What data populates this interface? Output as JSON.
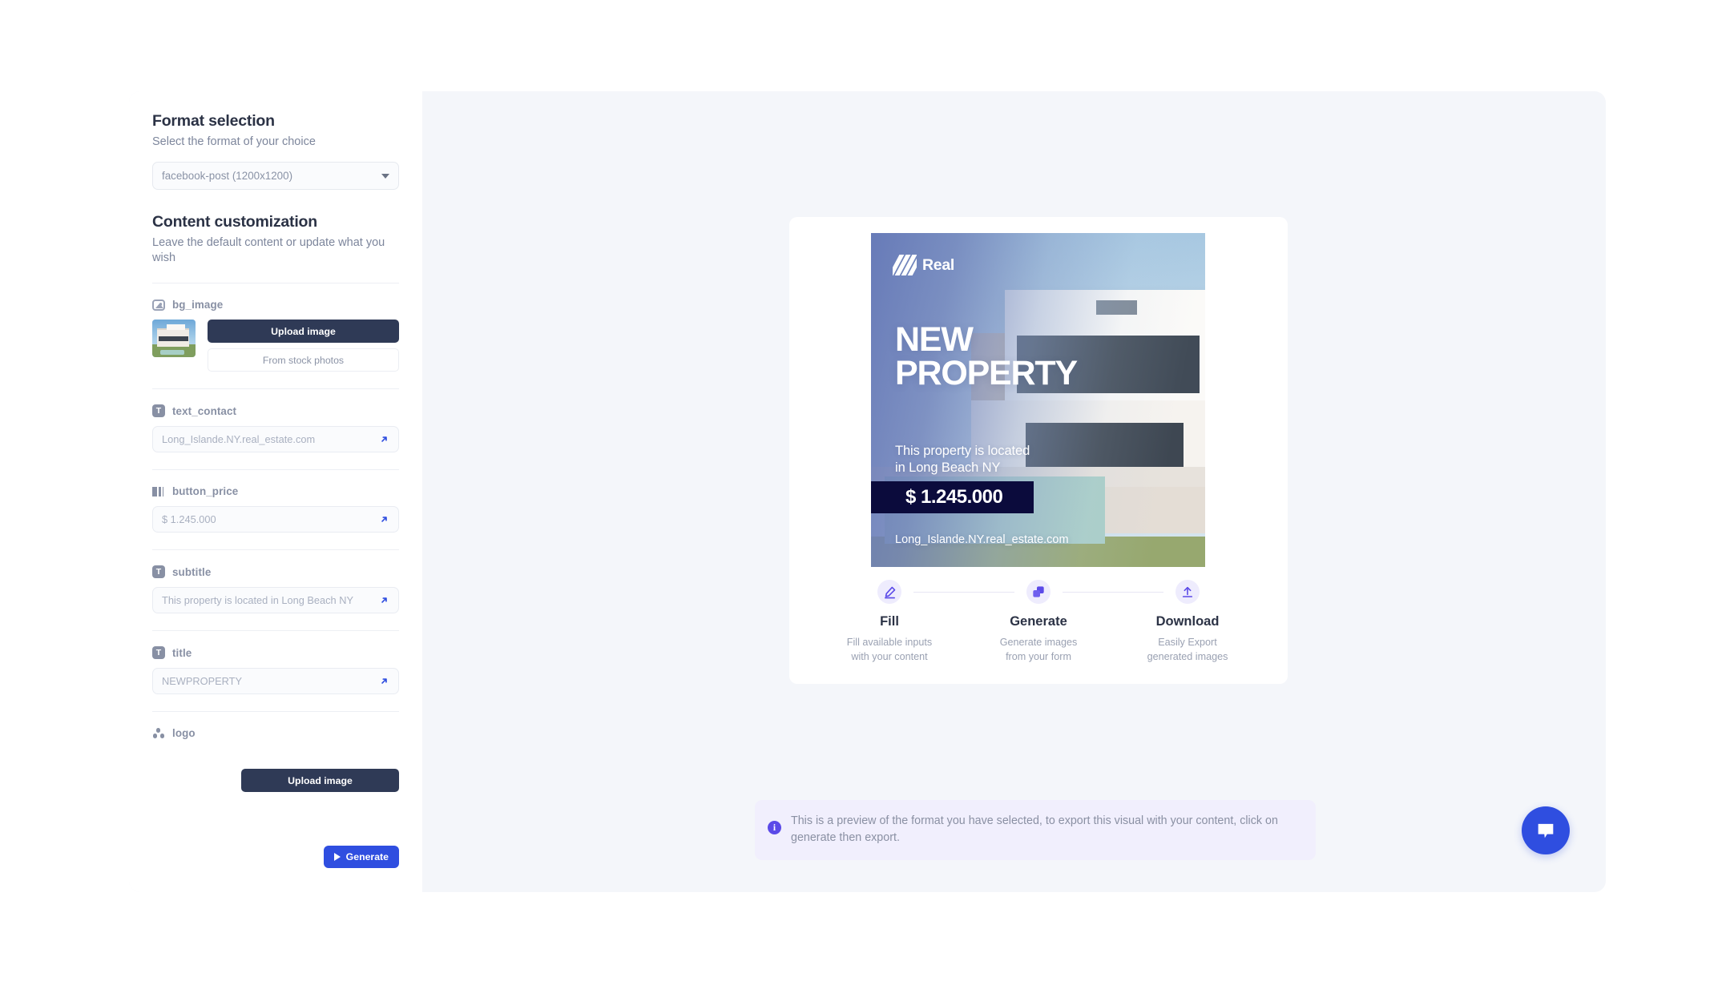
{
  "sidebar": {
    "format_section": {
      "title": "Format selection",
      "subtitle": "Select the format of your choice",
      "select_value": "facebook-post (1200x1200)"
    },
    "content_section": {
      "title": "Content customization",
      "subtitle": "Leave the default content or update what you wish"
    },
    "fields": [
      {
        "label": "bg_image",
        "icon": "picture-icon"
      },
      {
        "label": "text_contact",
        "icon": "text-icon",
        "value": "Long_Islande.NY.real_estate.com"
      },
      {
        "label": "button_price",
        "icon": "button-icon",
        "value": "$ 1.245.000"
      },
      {
        "label": "subtitle",
        "icon": "text-icon",
        "value": "This property is located in Long Beach NY"
      },
      {
        "label": "title",
        "icon": "text-icon",
        "value": "NEWPROPERTY"
      },
      {
        "label": "logo",
        "icon": "dots-icon"
      }
    ],
    "buttons": {
      "upload_image": "Upload image",
      "from_stock_photos": "From stock photos",
      "logo_upload_image": "Upload image",
      "generate": "Generate"
    }
  },
  "preview": {
    "poster": {
      "logo_text": "Real",
      "title": "NEW\nPROPERTY",
      "subtitle": "This property is located\nin Long Beach NY",
      "price": "$ 1.245.000",
      "url": "Long_Islande.NY.real_estate.com"
    },
    "steps": [
      {
        "icon": "pencil-icon",
        "name": "Fill",
        "desc": "Fill available inputs\nwith your content"
      },
      {
        "icon": "copy-icon",
        "name": "Generate",
        "desc": "Generate images\nfrom your form"
      },
      {
        "icon": "upload-icon",
        "name": "Download",
        "desc": "Easily Export\ngenerated images"
      }
    ],
    "info_banner": {
      "icon": "info-icon",
      "text": "This is a preview of the format you have selected, to export this visual with your content, click on generate then export."
    }
  },
  "chat": {
    "icon": "chat-bubble-icon"
  },
  "colors": {
    "accent_blue": "#2f4ee0",
    "accent_purple": "#5b4ae8",
    "dark_navy": "#2f3a56",
    "price_navy": "#0b0b3c",
    "page_bg": "#f4f6fa"
  }
}
